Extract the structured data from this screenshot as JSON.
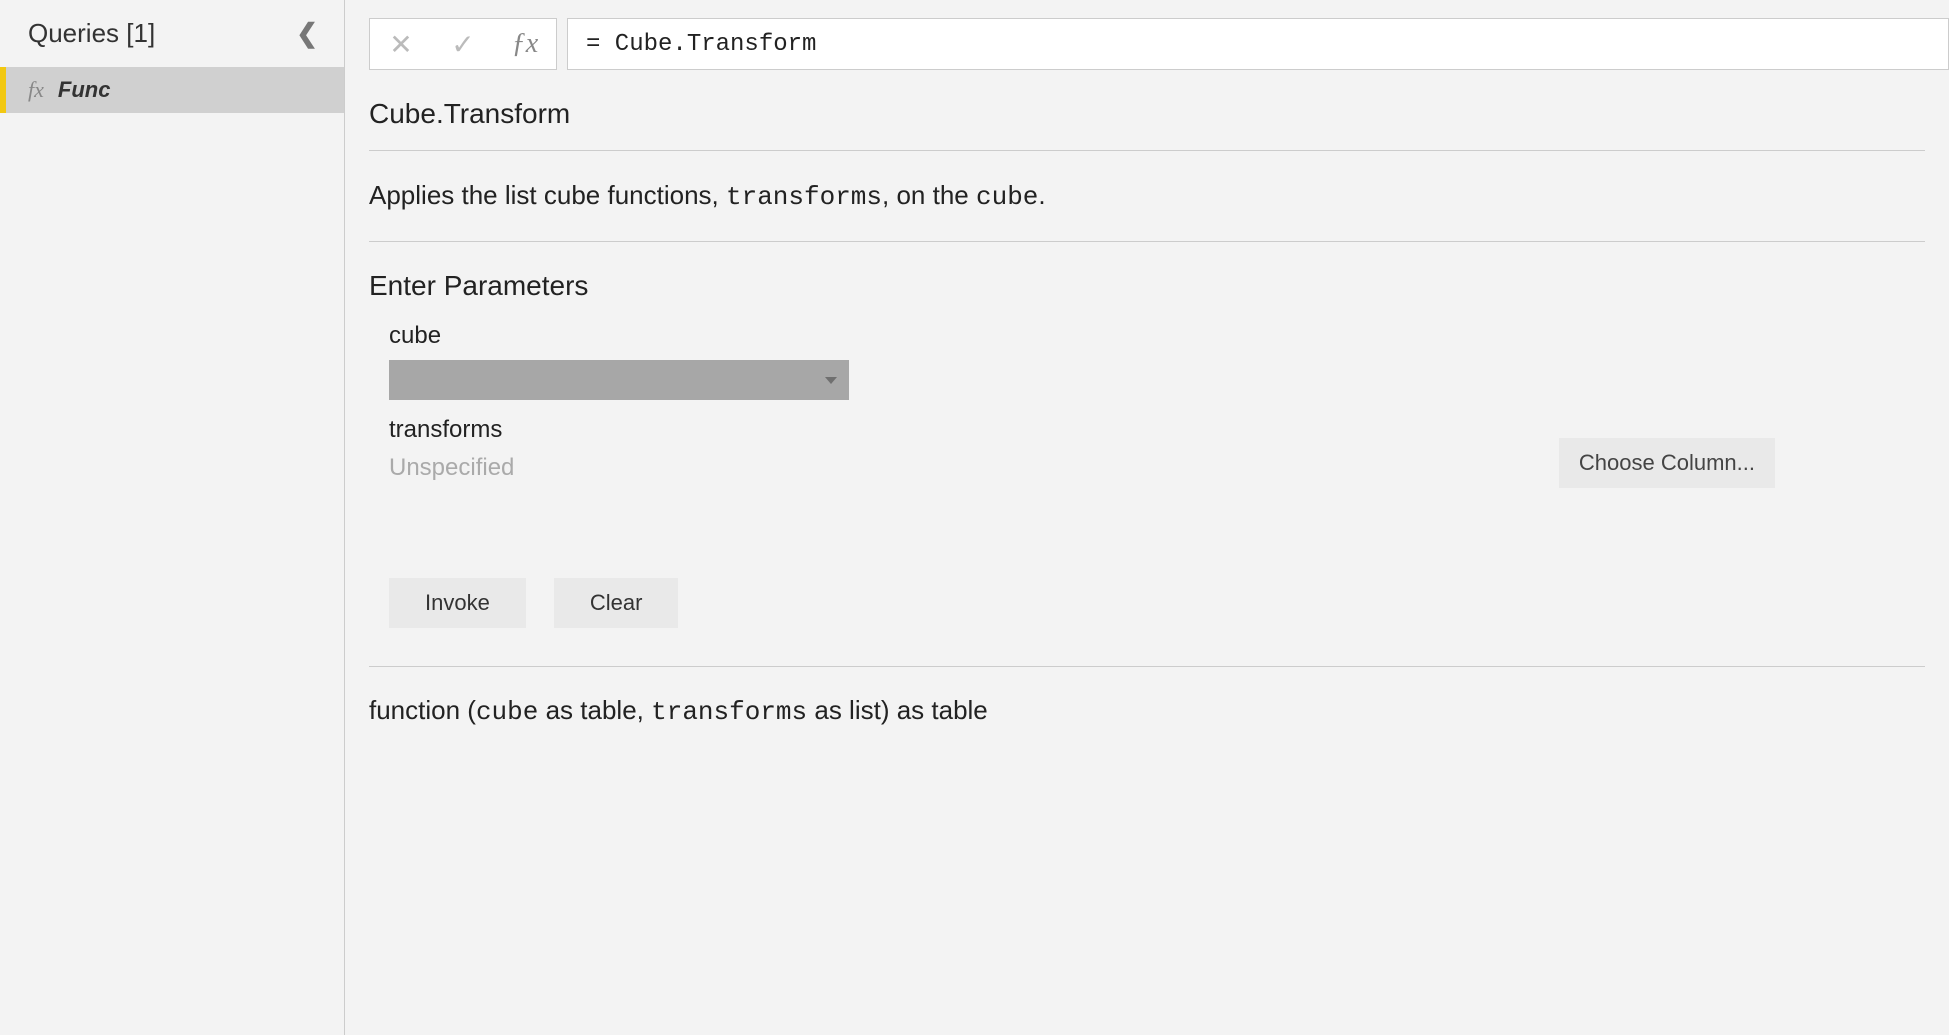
{
  "sidebar": {
    "title": "Queries [1]",
    "items": [
      {
        "icon": "fx",
        "label": "Func"
      }
    ]
  },
  "formula_bar": {
    "value": "= Cube.Transform"
  },
  "doc": {
    "title": "Cube.Transform",
    "desc_pre": "Applies the list cube functions, ",
    "desc_code1": "transforms",
    "desc_mid": ", on the ",
    "desc_code2": "cube",
    "desc_post": ".",
    "enter_params": "Enter Parameters",
    "params": {
      "p1_label": "cube",
      "p2_label": "transforms",
      "p2_value": "Unspecified"
    },
    "choose_column": "Choose Column...",
    "buttons": {
      "invoke": "Invoke",
      "clear": "Clear"
    },
    "signature": {
      "s1": "function (",
      "s2": "cube",
      "s3": " as table, ",
      "s4": "transforms",
      "s5": " as list) as table"
    }
  }
}
